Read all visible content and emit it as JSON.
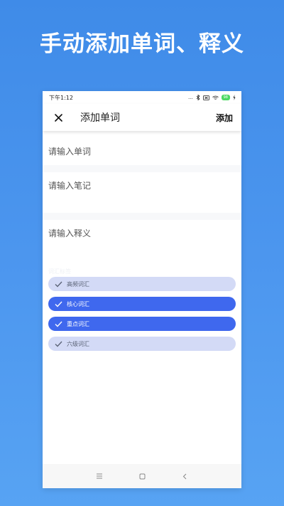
{
  "headline": "手动添加单词、释义",
  "status_bar": {
    "time": "下午1:12",
    "dots": "...",
    "battery": "98"
  },
  "app_bar": {
    "title": "添加单词",
    "add_label": "添加"
  },
  "form": {
    "word_placeholder": "请输入单词",
    "note_placeholder": "请输入笔记",
    "meaning_placeholder": "请输入释义"
  },
  "tags_label": "词汇标签",
  "tags": [
    {
      "label": "高频词汇",
      "selected": false
    },
    {
      "label": "核心词汇",
      "selected": true
    },
    {
      "label": "重点词汇",
      "selected": true
    },
    {
      "label": "六级词汇",
      "selected": false
    }
  ],
  "colors": {
    "accent": "#3f68ee",
    "tag_off": "#d3daf6",
    "background": "#4a93ec"
  },
  "icons": {
    "close": "close-icon",
    "check": "check-icon",
    "nav": [
      "menu-icon",
      "home-icon",
      "back-icon"
    ]
  }
}
